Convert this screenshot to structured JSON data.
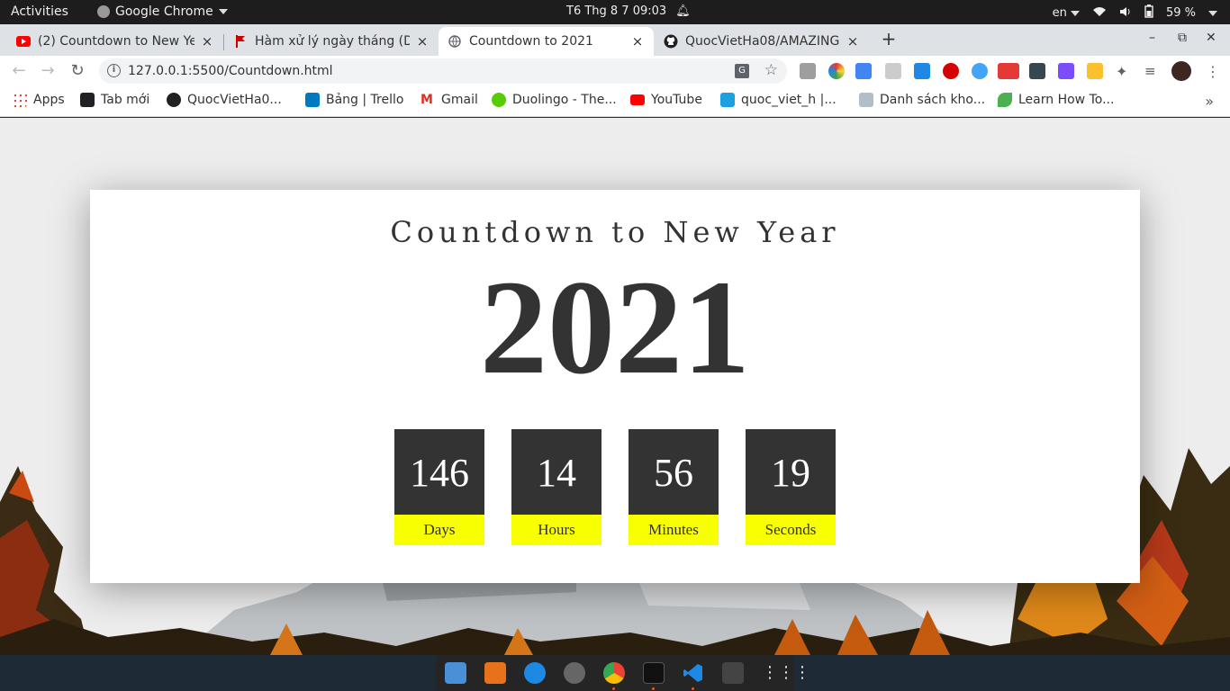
{
  "system_bar": {
    "activities": "Activities",
    "app_name": "Google Chrome",
    "clock": "T6 Thg 8 7  09:03",
    "language": "en",
    "battery": "59 %"
  },
  "tabs": [
    {
      "title": "(2) Countdown to New Ye",
      "favicon": "youtube-icon",
      "active": false
    },
    {
      "title": "Hàm xử lý ngày tháng (Da",
      "favicon": "flag-icon",
      "active": false
    },
    {
      "title": "Countdown to 2021",
      "favicon": "globe-icon",
      "active": true
    },
    {
      "title": "QuocVietHa08/AMAZING",
      "favicon": "github-icon",
      "active": false
    }
  ],
  "tab_close_glyph": "×",
  "new_tab_glyph": "+",
  "window_controls": {
    "minimize": "–",
    "maximize": "⧉",
    "close": "✕"
  },
  "address_bar": {
    "url": "127.0.0.1:5500/Countdown.html"
  },
  "bookmarks": [
    {
      "label": "Apps",
      "icon": "apps-grid-icon",
      "color": "#e94235"
    },
    {
      "label": "Tab mới",
      "icon": "tab-icon",
      "color": "#202124"
    },
    {
      "label": "QuocVietHa0...",
      "icon": "github-icon",
      "color": "#202124"
    },
    {
      "label": "Bảng | Trello",
      "icon": "trello-icon",
      "color": "#0079bf"
    },
    {
      "label": "Gmail",
      "icon": "gmail-icon",
      "color": "#d93025"
    },
    {
      "label": "Duolingo - The...",
      "icon": "duolingo-icon",
      "color": "#58cc02"
    },
    {
      "label": "YouTube",
      "icon": "youtube-icon",
      "color": "#ff0000"
    },
    {
      "label": "quoc_viet_h |...",
      "icon": "hackerrank-icon",
      "color": "#1ba94c"
    },
    {
      "label": "Danh sách kho...",
      "icon": "course-icon",
      "color": "#888888"
    },
    {
      "label": "Learn How To...",
      "icon": "leaf-icon",
      "color": "#4caf50"
    }
  ],
  "bookmarks_more": "»",
  "page": {
    "heading": "Countdown to New Year",
    "year": "2021",
    "countdown": [
      {
        "value": "146",
        "label": "Days"
      },
      {
        "value": "14",
        "label": "Hours"
      },
      {
        "value": "56",
        "label": "Minutes"
      },
      {
        "value": "19",
        "label": "Seconds"
      }
    ],
    "accent_color": "#f7ff00",
    "box_color": "#333333"
  }
}
